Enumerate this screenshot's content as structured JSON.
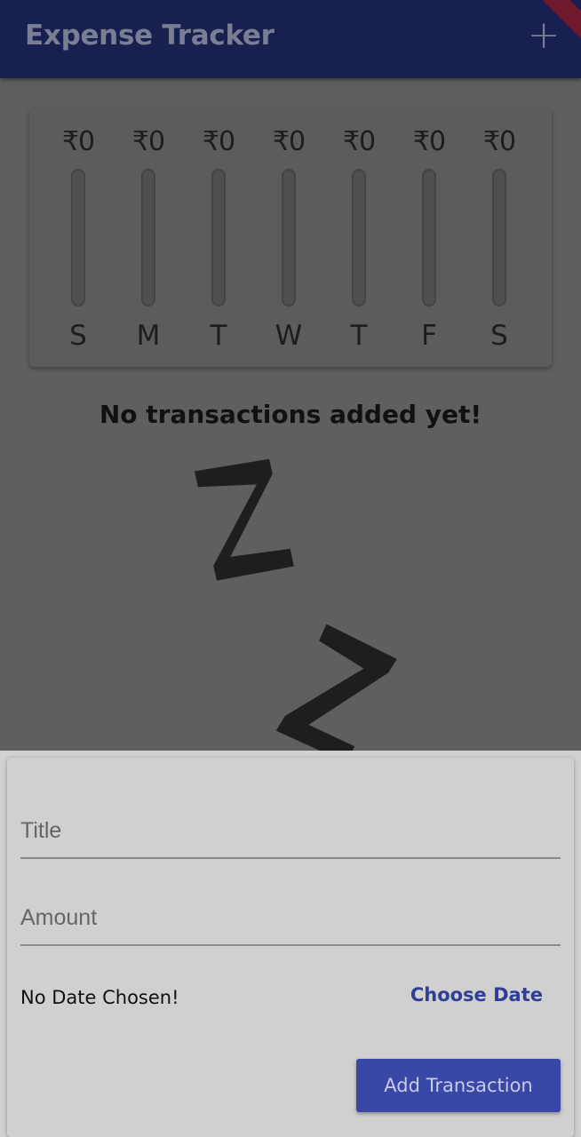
{
  "app_bar": {
    "title": "Expense Tracker",
    "add_icon": "plus-icon"
  },
  "chart": {
    "bars": [
      {
        "amount": "₹0",
        "day": "S",
        "fill_fraction": 0
      },
      {
        "amount": "₹0",
        "day": "M",
        "fill_fraction": 0
      },
      {
        "amount": "₹0",
        "day": "T",
        "fill_fraction": 0
      },
      {
        "amount": "₹0",
        "day": "W",
        "fill_fraction": 0
      },
      {
        "amount": "₹0",
        "day": "T",
        "fill_fraction": 0
      },
      {
        "amount": "₹0",
        "day": "F",
        "fill_fraction": 0
      },
      {
        "amount": "₹0",
        "day": "S",
        "fill_fraction": 0
      }
    ]
  },
  "empty_state": {
    "message": "No transactions added yet!",
    "illustration": "sleeping-z-icon"
  },
  "new_transaction": {
    "title_placeholder": "Title",
    "amount_placeholder": "Amount",
    "date_status": "No Date Chosen!",
    "choose_date_label": "Choose Date",
    "submit_label": "Add Transaction"
  },
  "colors": {
    "primary": "#3947a6",
    "app_bar": "#18204f",
    "accent_text": "#2e3f95"
  }
}
